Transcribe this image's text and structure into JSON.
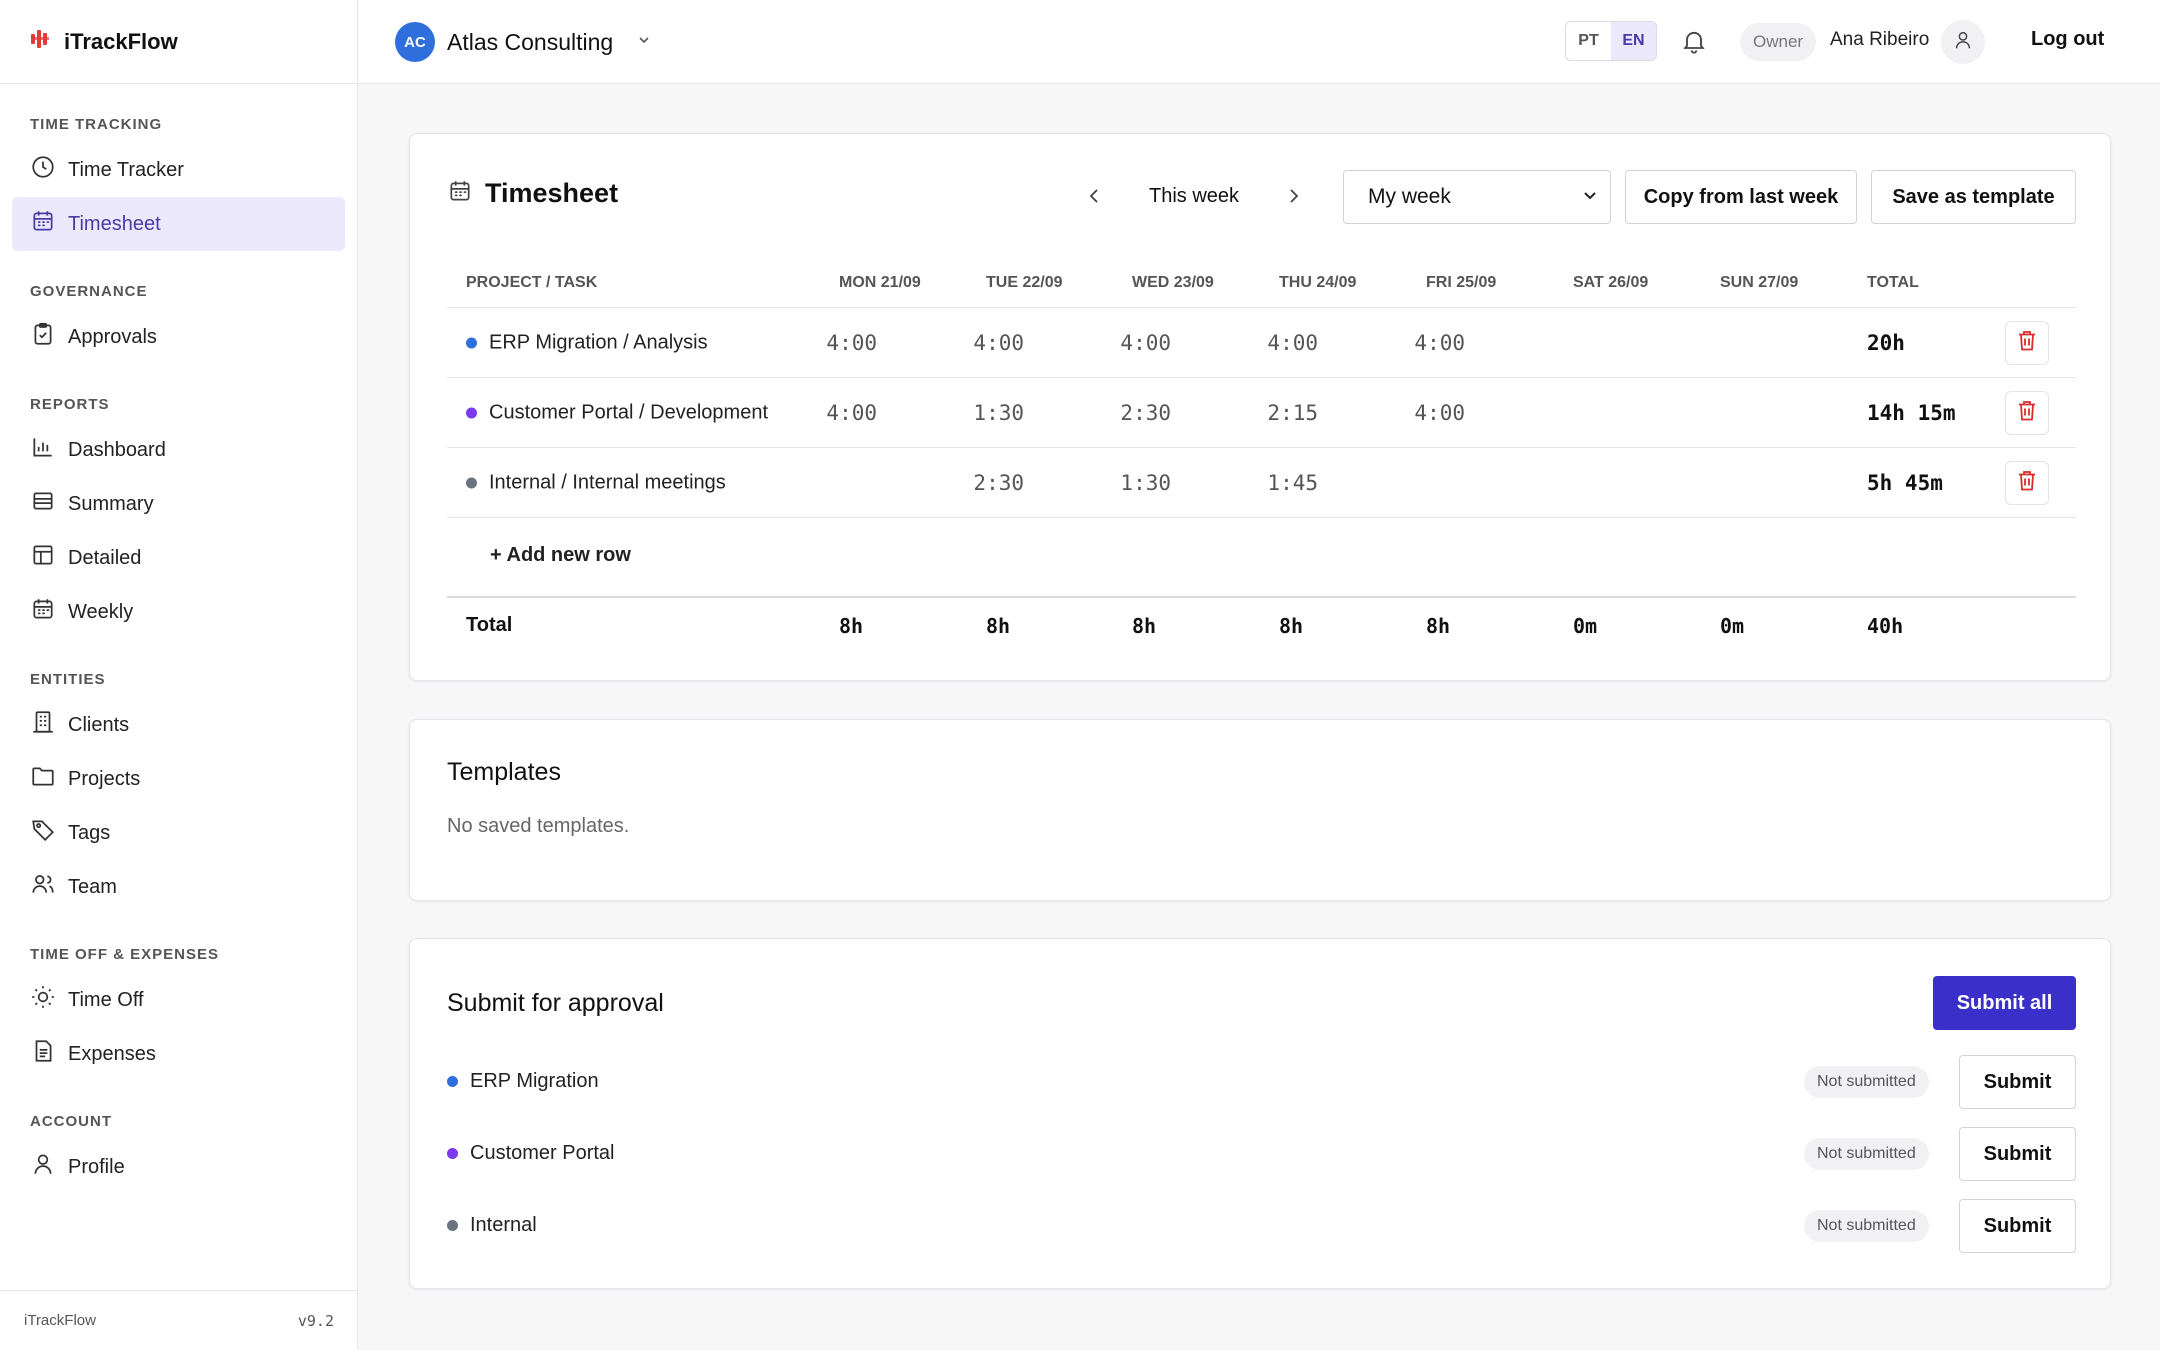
{
  "brand": {
    "name": "iTrackFlow",
    "footer_name": "iTrackFlow",
    "version": "v9.2",
    "accent": "#e23b3b"
  },
  "sidebar": {
    "sections": [
      {
        "heading": "TIME TRACKING",
        "items": [
          {
            "label": "Time Tracker",
            "icon": "clock-icon"
          },
          {
            "label": "Timesheet",
            "icon": "calendar-icon",
            "active": true
          }
        ]
      },
      {
        "heading": "GOVERNANCE",
        "items": [
          {
            "label": "Approvals",
            "icon": "clipboard-check-icon"
          }
        ]
      },
      {
        "heading": "REPORTS",
        "items": [
          {
            "label": "Dashboard",
            "icon": "bar-chart-icon"
          },
          {
            "label": "Summary",
            "icon": "list-icon"
          },
          {
            "label": "Detailed",
            "icon": "table-icon"
          },
          {
            "label": "Weekly",
            "icon": "calendar-icon"
          }
        ]
      },
      {
        "heading": "ENTITIES",
        "items": [
          {
            "label": "Clients",
            "icon": "building-icon"
          },
          {
            "label": "Projects",
            "icon": "folder-icon"
          },
          {
            "label": "Tags",
            "icon": "tag-icon"
          },
          {
            "label": "Team",
            "icon": "users-icon"
          }
        ]
      },
      {
        "heading": "TIME OFF & EXPENSES",
        "items": [
          {
            "label": "Time Off",
            "icon": "sun-icon"
          },
          {
            "label": "Expenses",
            "icon": "document-icon"
          }
        ]
      },
      {
        "heading": "ACCOUNT",
        "items": [
          {
            "label": "Profile",
            "icon": "user-icon"
          }
        ]
      }
    ]
  },
  "topbar": {
    "org_initials": "AC",
    "org_name": "Atlas Consulting",
    "lang_pt": "PT",
    "lang_en": "EN",
    "role": "Owner",
    "user_name": "Ana Ribeiro",
    "logout": "Log out"
  },
  "timesheet": {
    "title": "Timesheet",
    "week_label": "This week",
    "view_select": "My week",
    "copy_button": "Copy from last week",
    "template_button": "Save as template",
    "columns": [
      "PROJECT / TASK",
      "MON 21/09",
      "TUE 22/09",
      "WED 23/09",
      "THU 24/09",
      "FRI 25/09",
      "SAT 26/09",
      "SUN 27/09",
      "TOTAL"
    ],
    "rows": [
      {
        "task": "ERP Migration / Analysis",
        "color": "#2f6fdc",
        "days": [
          "4:00",
          "4:00",
          "4:00",
          "4:00",
          "4:00",
          "",
          ""
        ],
        "total": "20h"
      },
      {
        "task": "Customer Portal / Development",
        "color": "#7c3aed",
        "days": [
          "4:00",
          "1:30",
          "2:30",
          "2:15",
          "4:00",
          "",
          ""
        ],
        "total": "14h 15m"
      },
      {
        "task": "Internal / Internal meetings",
        "color": "#6b7280",
        "days": [
          "",
          "2:30",
          "1:30",
          "1:45",
          "",
          "",
          ""
        ],
        "total": "5h 45m"
      }
    ],
    "add_row": "+ Add new row",
    "footer_label": "Total",
    "footer_days": [
      "8h",
      "8h",
      "8h",
      "8h",
      "8h",
      "0m",
      "0m"
    ],
    "footer_total": "40h"
  },
  "templates": {
    "title": "Templates",
    "empty": "No saved templates."
  },
  "approval": {
    "title": "Submit for approval",
    "submit_all": "Submit all",
    "items": [
      {
        "name": "ERP Migration",
        "color": "#2f6fdc",
        "status": "Not submitted",
        "button": "Submit"
      },
      {
        "name": "Customer Portal",
        "color": "#7c3aed",
        "status": "Not submitted",
        "button": "Submit"
      },
      {
        "name": "Internal",
        "color": "#6b7280",
        "status": "Not submitted",
        "button": "Submit"
      }
    ]
  }
}
